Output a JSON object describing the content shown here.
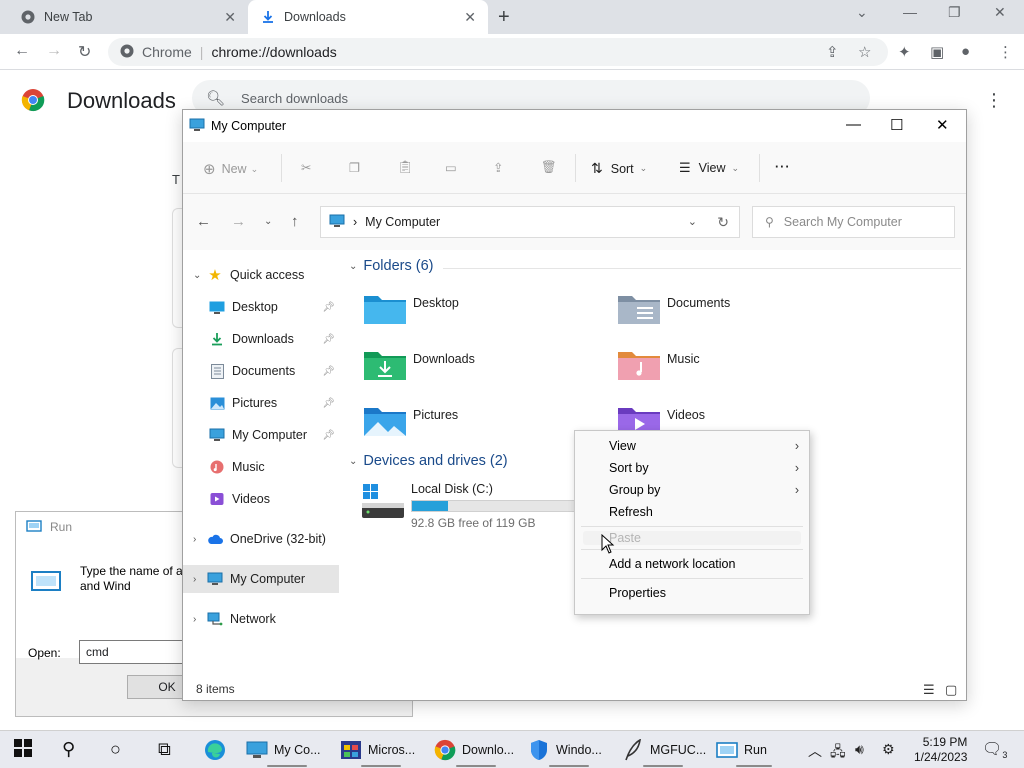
{
  "chrome": {
    "tabs": [
      {
        "title": "New Tab"
      },
      {
        "title": "Downloads"
      }
    ],
    "omnibox": {
      "site": "Chrome",
      "url": "chrome://downloads"
    },
    "page": {
      "title": "Downloads",
      "search_placeholder": "Search downloads",
      "partial_text": "T"
    }
  },
  "run_dialog": {
    "title": "Run",
    "description": "Type the name of a resource, and Wind",
    "open_label": "Open:",
    "open_value": "cmd",
    "ok_label": "OK"
  },
  "explorer": {
    "title": "My Computer",
    "commands": {
      "new": "New",
      "sort": "Sort",
      "view": "View",
      "more": "···"
    },
    "address": {
      "location": "My Computer"
    },
    "search_placeholder": "Search My Computer",
    "nav_pane": {
      "quick_access": "Quick access",
      "items": [
        {
          "label": "Desktop",
          "pinned": true
        },
        {
          "label": "Downloads",
          "pinned": true
        },
        {
          "label": "Documents",
          "pinned": true
        },
        {
          "label": "Pictures",
          "pinned": true
        },
        {
          "label": "My Computer",
          "pinned": true
        },
        {
          "label": "Music",
          "pinned": false
        },
        {
          "label": "Videos",
          "pinned": false
        }
      ],
      "onedrive": "OneDrive (32-bit)",
      "my_computer": "My Computer",
      "network": "Network"
    },
    "folders_header": "Folders (6)",
    "folders": [
      {
        "name": "Desktop"
      },
      {
        "name": "Documents"
      },
      {
        "name": "Downloads"
      },
      {
        "name": "Music"
      },
      {
        "name": "Pictures"
      },
      {
        "name": "Videos"
      }
    ],
    "devices_header": "Devices and drives (2)",
    "drive": {
      "name": "Local Disk (C:)",
      "free_text": "92.8 GB free of 119 GB",
      "used_fraction": 0.22
    },
    "status": "8 items"
  },
  "context_menu": {
    "items": [
      {
        "label": "View",
        "submenu": true
      },
      {
        "label": "Sort by",
        "submenu": true
      },
      {
        "label": "Group by",
        "submenu": true
      },
      {
        "label": "Refresh",
        "submenu": false
      }
    ],
    "paste": "Paste",
    "add_network": "Add a network location",
    "properties": "Properties"
  },
  "taskbar": {
    "apps": [
      {
        "label": "My Co..."
      },
      {
        "label": "Micros..."
      },
      {
        "label": "Downlo..."
      },
      {
        "label": "Windo..."
      },
      {
        "label": "MGFUC..."
      },
      {
        "label": "Run"
      }
    ],
    "time": "5:19 PM",
    "date": "1/24/2023",
    "notifications": "3"
  },
  "colors": {
    "accent": "#0078d4",
    "drive_fill": "#26a0da",
    "folder_header": "#1a4a8a"
  }
}
